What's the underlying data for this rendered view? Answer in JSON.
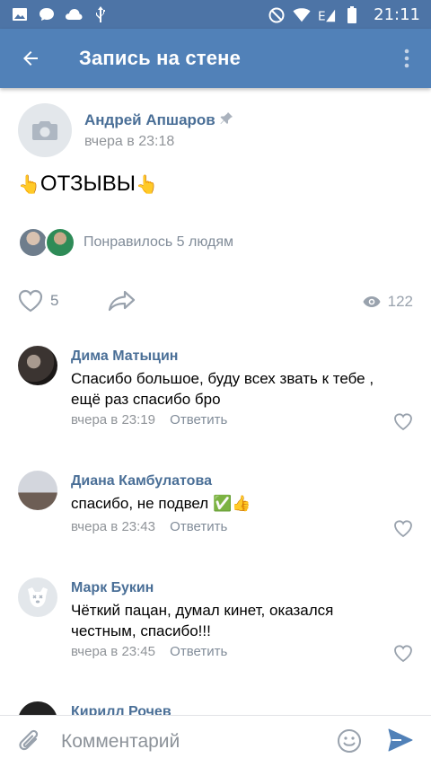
{
  "status_bar": {
    "time": "21:11",
    "icons": [
      "image-icon",
      "chat-bubble-icon",
      "cloud-icon",
      "usb-icon",
      "do-not-disturb-icon",
      "wifi-icon",
      "signal-e-icon",
      "battery-icon"
    ]
  },
  "toolbar": {
    "title": "Запись на стене"
  },
  "post": {
    "author": "Андрей Апшаров",
    "time": "вчера в 23:18",
    "text": "ОТЗЫВЫ",
    "text_emoji": "👆",
    "likes_text": "Понравилось 5 людям",
    "like_count": "5",
    "views": "122"
  },
  "comments": [
    {
      "name": "Дима Матыцин",
      "text": "Спасибо большое, буду всех звать к тебе , ещё раз спасибо бро",
      "time": "вчера в 23:19",
      "reply": "Ответить"
    },
    {
      "name": "Диана Камбулатова",
      "text": "спасибо, не подвел ✅👍",
      "time": "вчера в 23:43",
      "reply": "Ответить"
    },
    {
      "name": "Марк Букин",
      "text": "Чёткий пацан, думал кинет, оказался честным, спасибо!!!",
      "time": "вчера в 23:45",
      "reply": "Ответить"
    },
    {
      "name": "Кирилл Рочев"
    }
  ],
  "input": {
    "placeholder": "Комментарий"
  },
  "colors": {
    "status_bar": "#4d74a6",
    "toolbar": "#5181b8",
    "name_link": "#4a6f97",
    "send": "#5181b8"
  }
}
